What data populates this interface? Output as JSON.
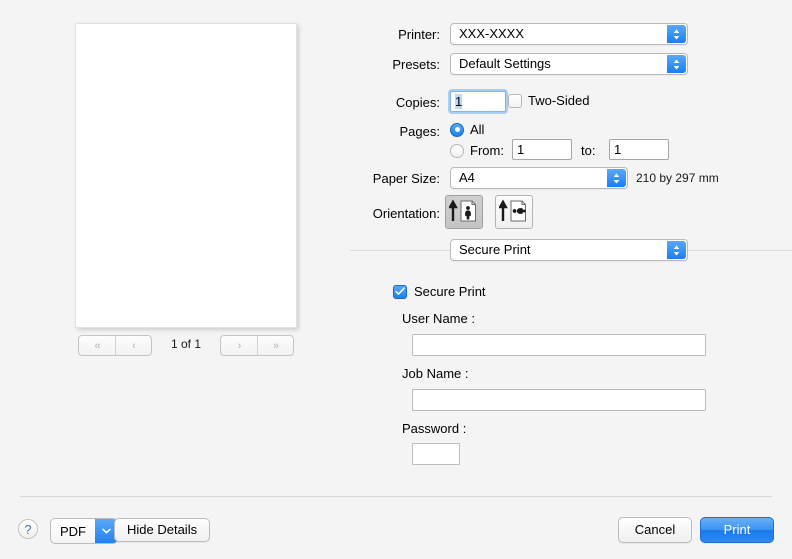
{
  "preview": {
    "page_indicator": "1 of 1",
    "nav": {
      "first_label": "«",
      "prev_label": "‹",
      "next_label": "›",
      "last_label": "»"
    }
  },
  "settings": {
    "printer": {
      "label": "Printer:",
      "value": "XXX-XXXX"
    },
    "presets": {
      "label": "Presets:",
      "value": "Default Settings"
    },
    "copies": {
      "label": "Copies:",
      "value": "1"
    },
    "two_sided": {
      "label": "Two-Sided",
      "checked": false
    },
    "pages": {
      "label": "Pages:",
      "all_label": "All",
      "all_selected": true,
      "from_label": "From:",
      "from_value": "1",
      "to_label": "to:",
      "to_value": "1"
    },
    "paper_size": {
      "label": "Paper Size:",
      "value": "A4",
      "dimensions": "210 by 297 mm"
    },
    "orientation": {
      "label": "Orientation:",
      "portrait_selected": true,
      "portrait_name": "portrait",
      "landscape_name": "landscape"
    },
    "feature_popup": {
      "value": "Secure Print"
    }
  },
  "secure_print": {
    "enable_label": "Secure Print",
    "enabled": true,
    "user_name": {
      "label": "User Name :",
      "value": ""
    },
    "job_name": {
      "label": "Job Name :",
      "value": ""
    },
    "password": {
      "label": "Password :",
      "value": ""
    }
  },
  "bottom": {
    "help_label": "?",
    "pdf_label": "PDF",
    "hide_details_label": "Hide Details",
    "cancel_label": "Cancel",
    "print_label": "Print"
  },
  "colors": {
    "accent_blue": "#1c80f0",
    "window_bg": "#f4f4f4",
    "selection_blue": "#bcd9f5"
  }
}
